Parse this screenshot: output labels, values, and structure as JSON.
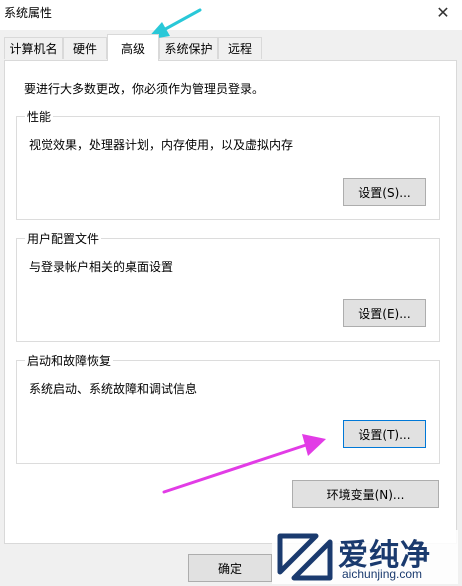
{
  "window": {
    "title": "系统属性",
    "close_glyph": "✕"
  },
  "tabs": [
    {
      "label": "计算机名"
    },
    {
      "label": "硬件"
    },
    {
      "label": "高级"
    },
    {
      "label": "系统保护"
    },
    {
      "label": "远程"
    }
  ],
  "active_tab": "高级",
  "panel": {
    "admin_note": "要进行大多数更改，你必须作为管理员登录。",
    "performance": {
      "title": "性能",
      "desc": "视觉效果，处理器计划，内存使用，以及虚拟内存",
      "button": "设置(S)..."
    },
    "user_profiles": {
      "title": "用户配置文件",
      "desc": "与登录帐户相关的桌面设置",
      "button": "设置(E)..."
    },
    "startup_recovery": {
      "title": "启动和故障恢复",
      "desc": "系统启动、系统故障和调试信息",
      "button": "设置(T)..."
    },
    "env_button": "环境变量(N)..."
  },
  "footer": {
    "ok_button": "确定"
  },
  "watermark": {
    "brand": "爱纯净",
    "url": "aichunjing.com"
  },
  "colors": {
    "cyan_arrow": "#29c8d8",
    "magenta_arrow": "#e23ce6",
    "focus_blue": "#0078d7",
    "brand_blue": "#1a3a6e"
  }
}
